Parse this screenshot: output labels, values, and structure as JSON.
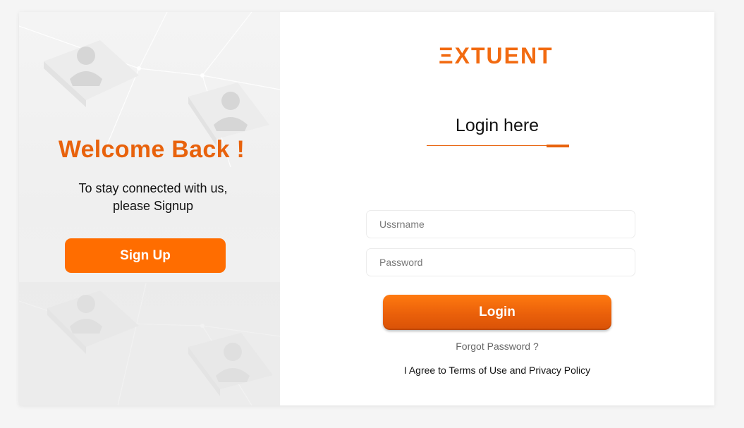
{
  "left_panel": {
    "heading": "Welcome Back !",
    "subtext_line1": "To stay connected with us,",
    "subtext_line2": "please Signup",
    "signup_label": "Sign Up"
  },
  "right_panel": {
    "logo_text": "ΞXTUENT",
    "title": "Login here",
    "username_placeholder": "Ussrname",
    "password_placeholder": "Password",
    "login_label": "Login",
    "forgot_label": "Forgot Password ?",
    "terms_prefix": "I Agree to ",
    "terms_link": "Terms of Use",
    "terms_and": " and ",
    "privacy_link": "Privacy Policy"
  },
  "colors": {
    "accent": "#ff6d00",
    "heading": "#e8620c",
    "background": "#f5f5f5"
  },
  "icons": [
    "user-profile-icon"
  ]
}
